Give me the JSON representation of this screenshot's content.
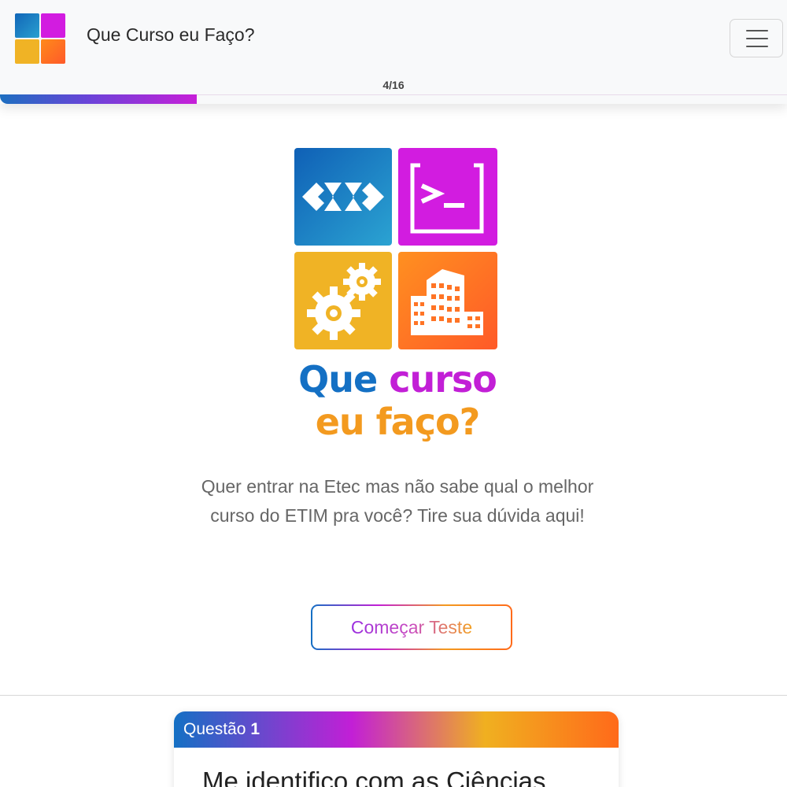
{
  "header": {
    "brand": "Que Curso eu Faço?",
    "menu_icon": "hamburger-menu-icon",
    "progress": {
      "label": "4/16",
      "current": 4,
      "total": 16,
      "fraction": 0.25
    }
  },
  "hero": {
    "logo_icons": [
      "code-brackets-icon",
      "terminal-icon",
      "gears-icon",
      "buildings-icon"
    ],
    "logo_title_line1_a": "Que",
    "logo_title_line1_b": "curso",
    "logo_title_line2": "eu faço?",
    "description": "Quer entrar na Etec mas não sabe qual o melhor curso do ETIM pra você? Tire sua dúvida aqui!",
    "start_button": "Começar Teste"
  },
  "question": {
    "label": "Questão",
    "number": "1",
    "text": "Me identifico com as Ciências"
  },
  "colors": {
    "blue": "#1470c4",
    "magenta": "#c21fd6",
    "yellow": "#f0b020",
    "orange": "#ff6a1a"
  }
}
